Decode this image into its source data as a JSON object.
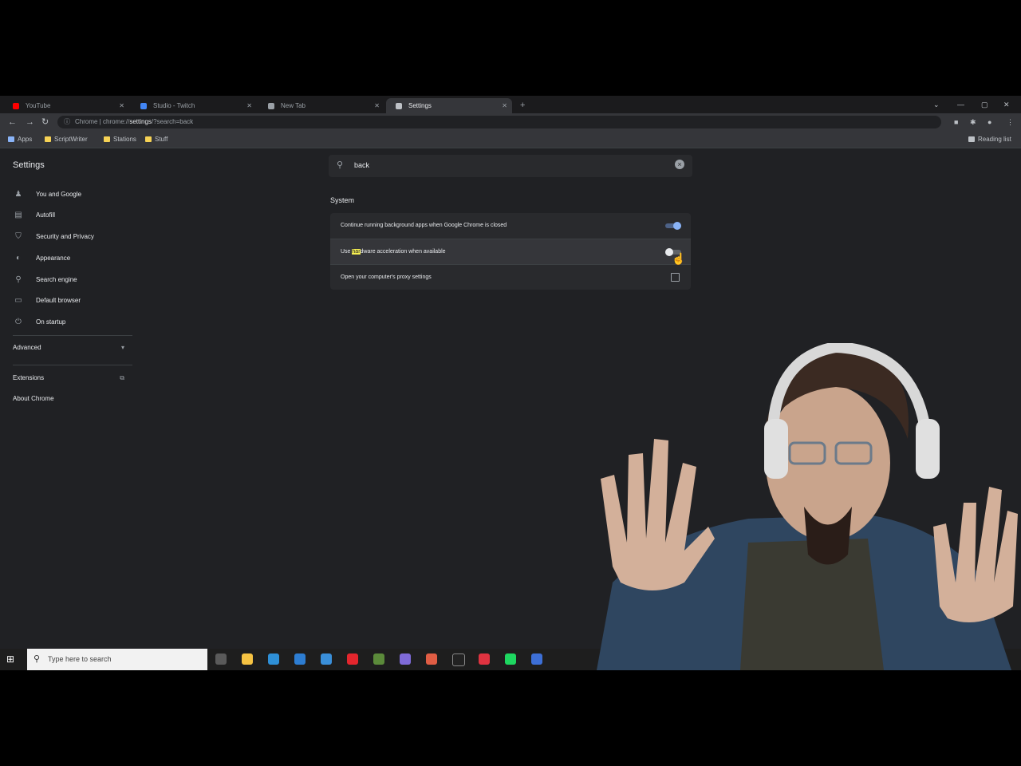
{
  "browser": {
    "tabs": [
      {
        "title": "YouTube",
        "icon": "youtube-icon",
        "color": "#ff0000"
      },
      {
        "title": "Studio - Twitch",
        "icon": "twitch-icon",
        "color": "#4285f4"
      },
      {
        "title": "New Tab",
        "icon": "generic-tab-icon",
        "color": "#9aa0a6"
      },
      {
        "title": "Settings",
        "icon": "settings-icon",
        "color": "#bdc1c6"
      }
    ],
    "new_tab_label": "+",
    "address": {
      "prefix": "Chrome | chrome://",
      "path": "settings",
      "suffix": "/?search=back"
    },
    "bookmarks": [
      {
        "label": "Apps"
      },
      {
        "label": "ScriptWriter"
      },
      {
        "label": "Stations"
      },
      {
        "label": "Stuff"
      }
    ],
    "other_bookmarks": "Reading list"
  },
  "settings": {
    "title": "Settings",
    "search_value": "back",
    "nav": [
      {
        "label": "You and Google",
        "icon": "person-icon"
      },
      {
        "label": "Autofill",
        "icon": "autofill-icon"
      },
      {
        "label": "Security and Privacy",
        "icon": "shield-icon"
      },
      {
        "label": "Appearance",
        "icon": "palette-icon"
      },
      {
        "label": "Search engine",
        "icon": "search-icon"
      },
      {
        "label": "Default browser",
        "icon": "browser-icon"
      },
      {
        "label": "On startup",
        "icon": "power-icon"
      }
    ],
    "advanced_label": "Advanced",
    "extensions_label": "Extensions",
    "about_label": "About Chrome",
    "section_title": "System",
    "rows": [
      {
        "before": "Continue running background apps when Google Chrome is closed",
        "highlight": "",
        "after": "",
        "control": "toggle-on"
      },
      {
        "before": "Use ",
        "highlight": "har",
        "after": "dware acceleration when available",
        "control": "toggle-off"
      },
      {
        "before": "Open your computer's proxy settings",
        "highlight": "",
        "after": "",
        "control": "external-link"
      }
    ]
  },
  "taskbar": {
    "search_placeholder": "Type here to search",
    "apps": [
      {
        "icon": "task-view-icon",
        "color": "#5a5a5a"
      },
      {
        "icon": "file-explorer-icon",
        "color": "#f6c343"
      },
      {
        "icon": "edge-icon",
        "color": "#2e8fd6"
      },
      {
        "icon": "store-icon",
        "color": "#2d7dd2"
      },
      {
        "icon": "mail-icon",
        "color": "#3a8fd9"
      },
      {
        "icon": "opera-icon",
        "color": "#e4262d"
      },
      {
        "icon": "minecraft-icon",
        "color": "#5b8a3a"
      },
      {
        "icon": "app-icon",
        "color": "#7e6ad8"
      },
      {
        "icon": "chrome-icon",
        "color": "#e05d44"
      },
      {
        "icon": "terminal-icon",
        "color": "#222222"
      },
      {
        "icon": "red-app-icon",
        "color": "#e03340"
      },
      {
        "icon": "spotify-icon",
        "color": "#1ed760"
      },
      {
        "icon": "headset-app-icon",
        "color": "#3d6fd6"
      }
    ]
  }
}
